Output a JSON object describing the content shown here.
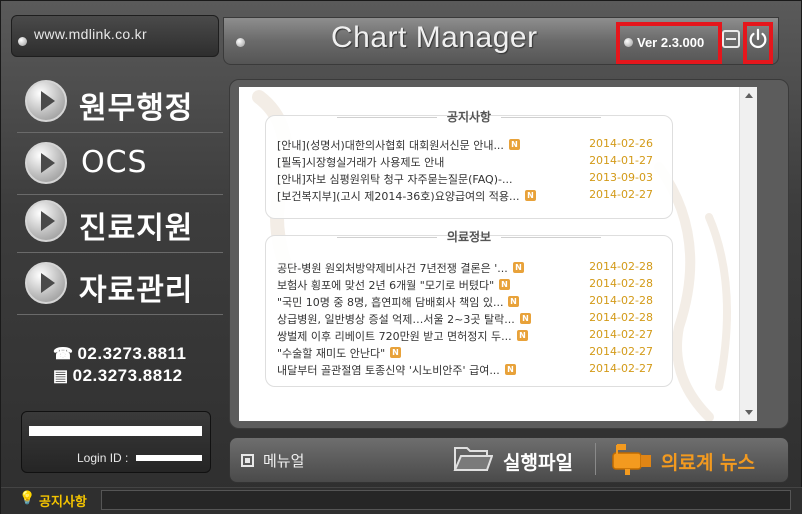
{
  "window": {
    "url": "www.mdlink.co.kr",
    "title": "Chart Manager",
    "version": "Ver 2.3.000"
  },
  "sidebar": {
    "items": [
      {
        "label": "원무행정"
      },
      {
        "label": "OCS"
      },
      {
        "label": "진료지원"
      },
      {
        "label": "자료관리"
      }
    ],
    "phone": "02.3273.8811",
    "fax": "02.3273.8812",
    "login_label": "Login ID :"
  },
  "notice": {
    "title": "공지사항",
    "items": [
      {
        "title": "[안내](성명서)대한의사협회 대회원서신문 안내...",
        "badge": "N",
        "date": "2014-02-26"
      },
      {
        "title": "[필독]시장형실거래가 사용제도 안내",
        "badge": "",
        "date": "2014-01-27"
      },
      {
        "title": "[안내]자보 심평원위탁 청구 자주묻는질문(FAQ)-...",
        "badge": "",
        "date": "2013-09-03"
      },
      {
        "title": "[보건복지부](고시 제2014-36호)요양급여의 적용...",
        "badge": "N",
        "date": "2014-02-27"
      }
    ]
  },
  "medical": {
    "title": "의료정보",
    "items": [
      {
        "title": "공단-병원 원외처방약제비사건 7년전쟁 결론은 '...",
        "badge": "N",
        "date": "2014-02-28"
      },
      {
        "title": "보험사 횡포에 맞선 2년 6개월 \"모기로 버텼다\"",
        "badge": "N",
        "date": "2014-02-28"
      },
      {
        "title": "\"국민 10명 중 8명, 흡연피해 담배회사 책임 있...",
        "badge": "N",
        "date": "2014-02-28"
      },
      {
        "title": "상급병원, 일반병상 증설 억제…서울 2~3곳 탈락...",
        "badge": "N",
        "date": "2014-02-28"
      },
      {
        "title": "쌍벌제 이후 리베이트 720만원 받고 면허정지 두...",
        "badge": "N",
        "date": "2014-02-27"
      },
      {
        "title": "\"수술할 재미도 안난다\"",
        "badge": "N",
        "date": "2014-02-27"
      },
      {
        "title": "내달부터 골관절염 토종신약 '시노비안주' 급여...",
        "badge": "N",
        "date": "2014-02-27"
      }
    ]
  },
  "bottom": {
    "manual": "메뉴얼",
    "exec": "실행파일",
    "news": "의료계 뉴스"
  },
  "status": {
    "label": "공지사항"
  },
  "colors": {
    "accent_orange": "#f39a1f",
    "date_gold": "#d39a18",
    "highlight_red": "#e5161c",
    "status_yellow": "#f4c400"
  }
}
